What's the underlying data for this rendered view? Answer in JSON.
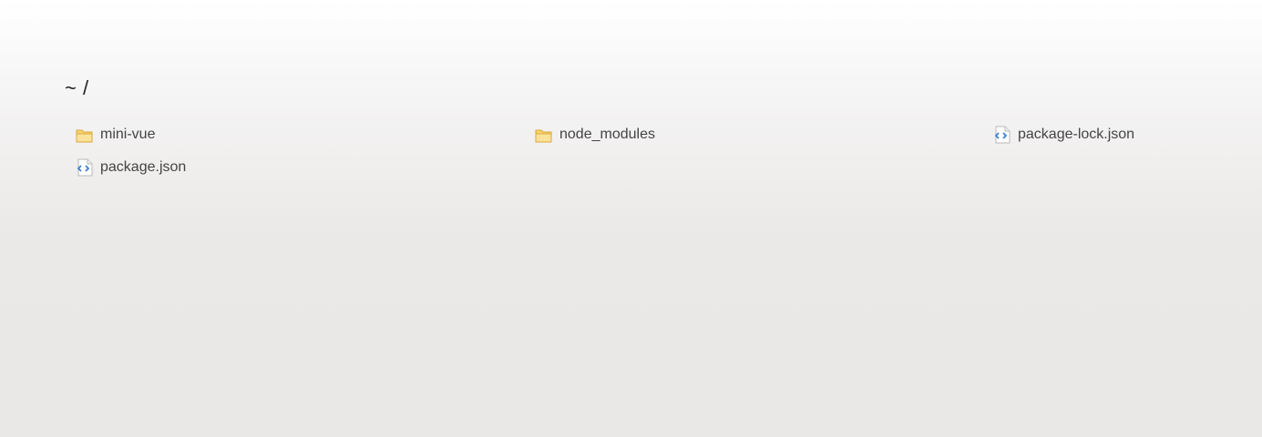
{
  "breadcrumb": {
    "title": "~ /"
  },
  "files": [
    {
      "name": "mini-vue",
      "type": "folder",
      "icon": "folder-icon"
    },
    {
      "name": "node_modules",
      "type": "folder",
      "icon": "folder-icon"
    },
    {
      "name": "package-lock.json",
      "type": "file",
      "icon": "json-file-icon"
    },
    {
      "name": "package.json",
      "type": "file",
      "icon": "json-file-icon"
    }
  ],
  "colors": {
    "folder_fill": "#f7d36b",
    "folder_stroke": "#d9a93a",
    "file_accent": "#3b82d6"
  }
}
